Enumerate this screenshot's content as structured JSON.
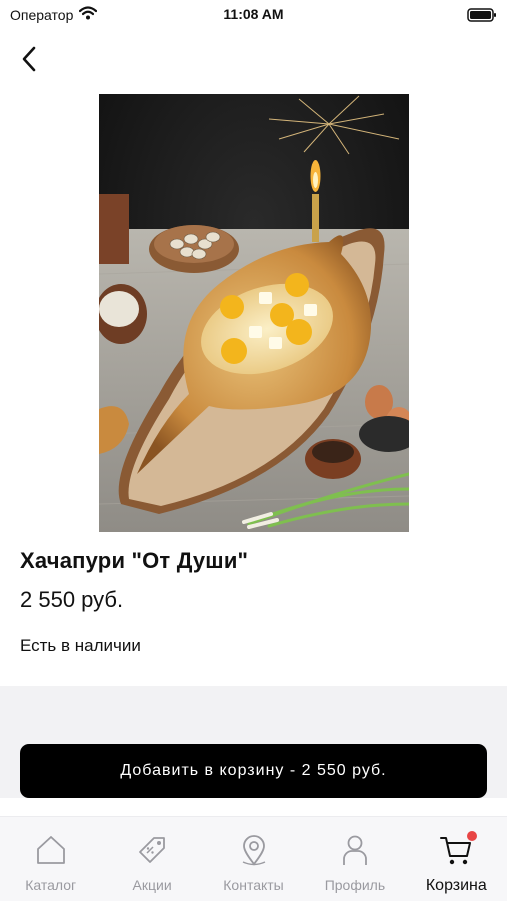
{
  "status_bar": {
    "carrier": "Оператор",
    "time": "11:08 AM"
  },
  "nav": {
    "back_icon": "chevron-left-icon"
  },
  "product": {
    "image_alt": "",
    "title": "Хачапури \"От Души\"",
    "price": "2 550 руб.",
    "stock": "Есть в наличии"
  },
  "cart_button": {
    "label": "Добавить в корзину - 2 550 руб."
  },
  "tab_bar": {
    "items": [
      {
        "label": "Каталог",
        "icon": "home-icon",
        "active": false
      },
      {
        "label": "Акции",
        "icon": "tag-icon",
        "active": false
      },
      {
        "label": "Контакты",
        "icon": "location-pin-icon",
        "active": false
      },
      {
        "label": "Профиль",
        "icon": "user-icon",
        "active": false
      },
      {
        "label": "Корзина",
        "icon": "cart-icon",
        "active": true
      }
    ]
  },
  "colors": {
    "accent": "#000000",
    "badge": "#e84545",
    "inactive_tab": "#9a9aa0"
  }
}
